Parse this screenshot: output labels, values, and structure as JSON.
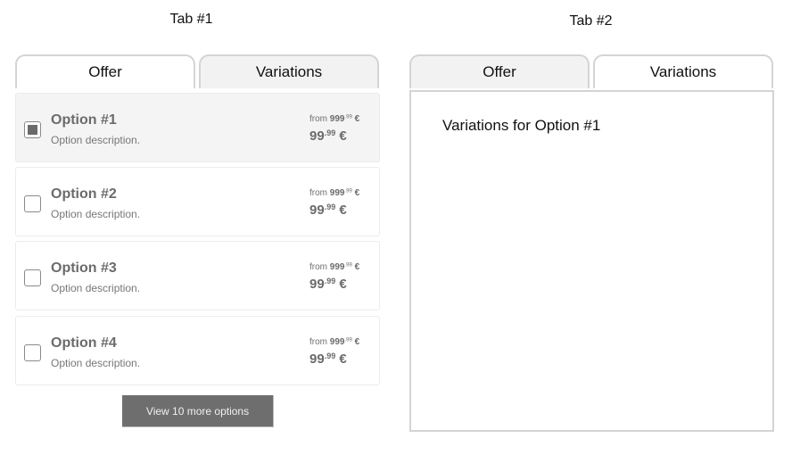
{
  "panels": {
    "tab1": {
      "caption": "Tab #1",
      "tabs": [
        {
          "label": "Offer",
          "active": true
        },
        {
          "label": "Variations",
          "active": false
        }
      ],
      "options": [
        {
          "name": "Option #1",
          "description": "Option description.",
          "checked": true,
          "from_label": "from",
          "old_price_int": "999",
          "old_price_cents": ".99",
          "currency": "€",
          "price_int": "99",
          "price_cents": ".99"
        },
        {
          "name": "Option #2",
          "description": "Option description.",
          "checked": false,
          "from_label": "from",
          "old_price_int": "999",
          "old_price_cents": ".99",
          "currency": "€",
          "price_int": "99",
          "price_cents": ".99"
        },
        {
          "name": "Option #3",
          "description": "Option description.",
          "checked": false,
          "from_label": "from",
          "old_price_int": "999",
          "old_price_cents": ".99",
          "currency": "€",
          "price_int": "99",
          "price_cents": ".99"
        },
        {
          "name": "Option #4",
          "description": "Option description.",
          "checked": false,
          "from_label": "from",
          "old_price_int": "999",
          "old_price_cents": ".99",
          "currency": "€",
          "price_int": "99",
          "price_cents": ".99"
        }
      ],
      "more_button_label": "View 10 more options"
    },
    "tab2": {
      "caption": "Tab #2",
      "tabs": [
        {
          "label": "Offer",
          "active": false
        },
        {
          "label": "Variations",
          "active": true
        }
      ],
      "variations_title": "Variations for Option #1"
    }
  },
  "colors": {
    "border": "#d4d4d4",
    "inactive_tab_bg": "#f2f2f2",
    "selected_card_bg": "#f4f4f4",
    "button_bg": "#6e6e6e",
    "text_muted": "#6b6b6b"
  }
}
